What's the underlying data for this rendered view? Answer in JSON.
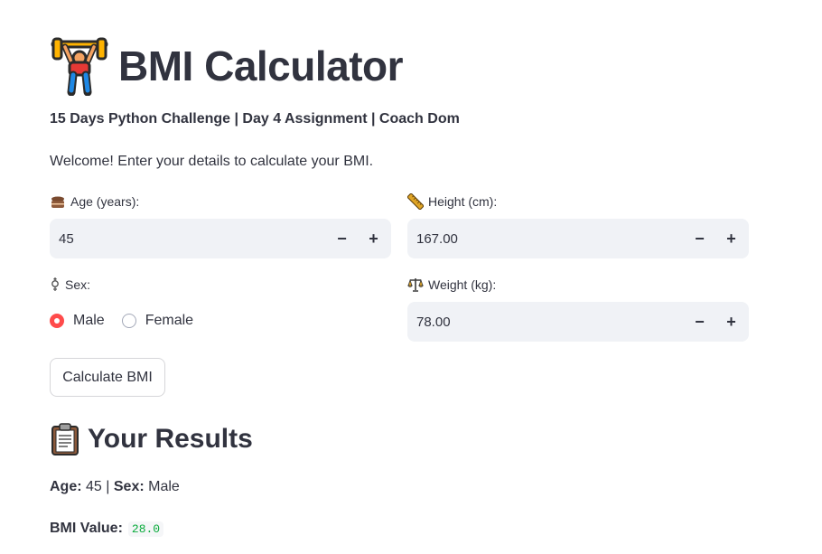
{
  "header": {
    "title": "BMI Calculator",
    "icon": "weightlifter-emoji",
    "subtitle": "15 Days Python Challenge | Day 4 Assignment | Coach Dom",
    "welcome": "Welcome! Enter your details to calculate your BMI."
  },
  "form": {
    "age": {
      "icon": "cake-icon",
      "label": "Age (years):",
      "value": "45"
    },
    "height": {
      "icon": "ruler-icon",
      "label": "Height (cm):",
      "value": "167.00"
    },
    "sex": {
      "icon": "transgender-symbol-icon",
      "label": "Sex:",
      "options": [
        "Male",
        "Female"
      ],
      "selected": "Male"
    },
    "weight": {
      "icon": "scales-icon",
      "label": "Weight (kg):",
      "value": "78.00"
    },
    "stepper": {
      "minus": "−",
      "plus": "+"
    },
    "submit_label": "Calculate BMI"
  },
  "results": {
    "icon": "clipboard-icon",
    "title": "Your Results",
    "age_label": "Age:",
    "age_value": "45",
    "separator": "|",
    "sex_label": "Sex:",
    "sex_value": "Male",
    "bmi_label": "BMI Value:",
    "bmi_value": "28.0"
  },
  "colors": {
    "accent": "#ff4b4b",
    "input_bg": "#f0f2f6",
    "text": "#31333f",
    "code_green": "#09ab3b"
  }
}
